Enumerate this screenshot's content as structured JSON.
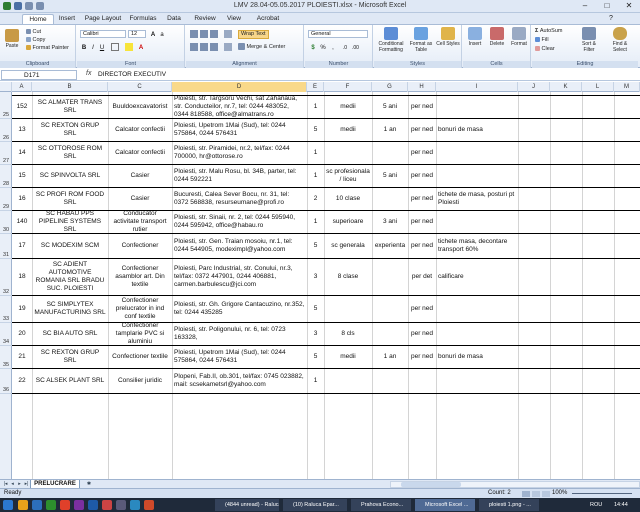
{
  "window": {
    "title": "LMV 28.04-05.05.2017 PLOIESTI.xlsx - Microsoft Excel",
    "controls": [
      "–",
      "□",
      "✕"
    ]
  },
  "ribbon": {
    "tabs": [
      "Home",
      "Insert",
      "Page Layout",
      "Formulas",
      "Data",
      "Review",
      "View",
      "Acrobat"
    ],
    "active_tab": "Home",
    "clipboard": {
      "paste": "Paste",
      "cut": "Cut",
      "copy": "Copy",
      "format_painter": "Format Painter",
      "label": "Clipboard"
    },
    "font": {
      "name": "Calibri",
      "size": "12",
      "label": "Font"
    },
    "alignment": {
      "wrap": "Wrap Text",
      "merge": "Merge & Center",
      "label": "Alignment"
    },
    "number": {
      "format": "General",
      "label": "Number"
    },
    "styles": {
      "conditional": "Conditional Formatting",
      "format_table": "Format as Table",
      "cell_styles": "Cell Styles",
      "label": "Styles"
    },
    "cells": {
      "insert": "Insert",
      "delete": "Delete",
      "format": "Format",
      "label": "Cells"
    },
    "editing": {
      "autosum": "AutoSum",
      "fill": "Fill",
      "clear": "Clear",
      "sort": "Sort & Filter",
      "find": "Find & Select",
      "label": "Editing"
    }
  },
  "formula_bar": {
    "name_box": "D171",
    "fx": "fx",
    "content": "DIRECTOR EXECUTIV"
  },
  "sheet": {
    "columns": [
      "A",
      "B",
      "C",
      "D",
      "E",
      "F",
      "G",
      "H",
      "I",
      "J",
      "K",
      "L",
      "M"
    ],
    "selected_column": "D",
    "rows": [
      {
        "row": "25",
        "a": "152",
        "b": "SC ALMATER TRANS SRL",
        "c": "Buuldoexcavatorist",
        "d": "Ploiesti, str. Targsoru Vechi, sat Zahanaua, str. Conducteilor, nr.7, tel: 0244 483052, 0344 818588, office@almatrans.ro",
        "e": "1",
        "f": "medii",
        "g": "5 ani",
        "h": "per ned",
        "i": ""
      },
      {
        "row": "26",
        "a": "13",
        "b": "SC REXTON GRUP SRL",
        "c": "Calcator confectii",
        "d": "Ploiesti, Upetrom 1Mai (Sud), tel: 0244 575864, 0244 576431",
        "e": "5",
        "f": "medii",
        "g": "1 an",
        "h": "per ned",
        "i": "bonuri de masa"
      },
      {
        "row": "27",
        "a": "14",
        "b": "SC OTTOROSE ROM SRL",
        "c": "Calcator confectii",
        "d": "Ploiesti, str. Piramidei, nr.2, tel/fax: 0244 700000, hr@ottorose.ro",
        "e": "1",
        "f": "",
        "g": "",
        "h": "per ned",
        "i": ""
      },
      {
        "row": "28",
        "a": "15",
        "b": "SC SPINVOLTA SRL",
        "c": "Casier",
        "d": "Ploiesti, str. Malu Rosu, bl. 34B, parter, tel: 0244 592221",
        "e": "1",
        "f": "sc profesionala / liceu",
        "g": "5 ani",
        "h": "per ned",
        "i": ""
      },
      {
        "row": "29",
        "a": "16",
        "b": "SC PROFI ROM FOOD SRL",
        "c": "Casier",
        "d": "Bucuresti, Calea Sever Bocu, nr. 31, tel: 0372 568838, resurseumane@profi.ro",
        "e": "2",
        "f": "10 clase",
        "g": "",
        "h": "per ned",
        "i": "tichete de masa, posturi pt Ploiesti"
      },
      {
        "row": "30",
        "a": "140",
        "b": "SC HABAU PPS PIPELINE SYSTEMS SRL",
        "c": "Conducator activitate transport rutier",
        "d": "Ploiesti, str. Sinaii, nr. 2, tel: 0244 595940, 0244 595942, office@habau.ro",
        "e": "1",
        "f": "superioare",
        "g": "3 ani",
        "h": "per ned",
        "i": ""
      },
      {
        "row": "31",
        "a": "17",
        "b": "SC MODEXIM SCM",
        "c": "Confectioner",
        "d": "Ploiesti, str. Gen. Traian mosoiu, nr.1, tel: 0244 544905, modeximpl@yahoo.com",
        "e": "5",
        "f": "sc generala",
        "g": "experienta",
        "h": "per ned",
        "i": "tichete masa, decontare transport 60%"
      },
      {
        "row": "32",
        "a": "18",
        "b": "SC ADIENT AUTOMOTIVE ROMANIA SRL BRADU SUC. PLOIESTI",
        "c": "Confectioner asamblor art. Din textile",
        "d": "Ploiesti, Parc Industrial, str. Conului, nr.3, tel/fax: 0372 447901, 0244 406881, carmen.barbulescu@jci.com",
        "e": "3",
        "f": "8 clase",
        "g": "",
        "h": "per det",
        "i": "calificare"
      },
      {
        "row": "33",
        "a": "19",
        "b": "SC SIMPLYTEX MANUFACTURING SRL",
        "c": "Confectioner prelucrator in ind conf textile",
        "d": "Ploiesti, str. Gh. Grigore Cantacuzino, nr.352, tel: 0244 435285",
        "e": "5",
        "f": "",
        "g": "",
        "h": "per ned",
        "i": ""
      },
      {
        "row": "34",
        "a": "20",
        "b": "SC BIA AUTO SRL",
        "c": "Confectioner tamplarie PVC si aluminiu",
        "d": "Ploiesti, str. Poligonului, nr. 6, tel: 0723 163328,",
        "e": "3",
        "f": "8 cls",
        "g": "",
        "h": "per ned",
        "i": ""
      },
      {
        "row": "35",
        "a": "21",
        "b": "SC REXTON GRUP SRL",
        "c": "Confectioner textile",
        "d": "Ploiesti, Upetrom 1Mai (Sud), tel: 0244 575864, 0244 576431",
        "e": "5",
        "f": "medii",
        "g": "1 an",
        "h": "per ned",
        "i": "bonuri de masa"
      },
      {
        "row": "36",
        "a": "22",
        "b": "SC ALSEK PLANT SRL",
        "c": "Consilier juridic",
        "d": "Plopeni, Fab.II, ob.301, tel/fax: 0745 023882, mail: scsekametsrl@yahoo.com",
        "e": "1",
        "f": "",
        "g": "",
        "h": "",
        "i": ""
      }
    ]
  },
  "sheet_tabs": {
    "active": "PRELUCRARE"
  },
  "status_bar": {
    "ready": "Ready",
    "count": "Count: 2",
    "zoom": "100%"
  },
  "taskbar": {
    "items": [
      "(4844 unread) - Raluca",
      "(10) Raluca Epar...",
      "Prahova Econo...",
      "Microsoft Excel ...",
      "ploiesti 1.png - ..."
    ],
    "lang": "ROU",
    "time": "14:44"
  },
  "colors": {
    "accent": "#dfe8f5",
    "selected_header": "#f9d98a",
    "taskbar": "#1f2a3a"
  }
}
